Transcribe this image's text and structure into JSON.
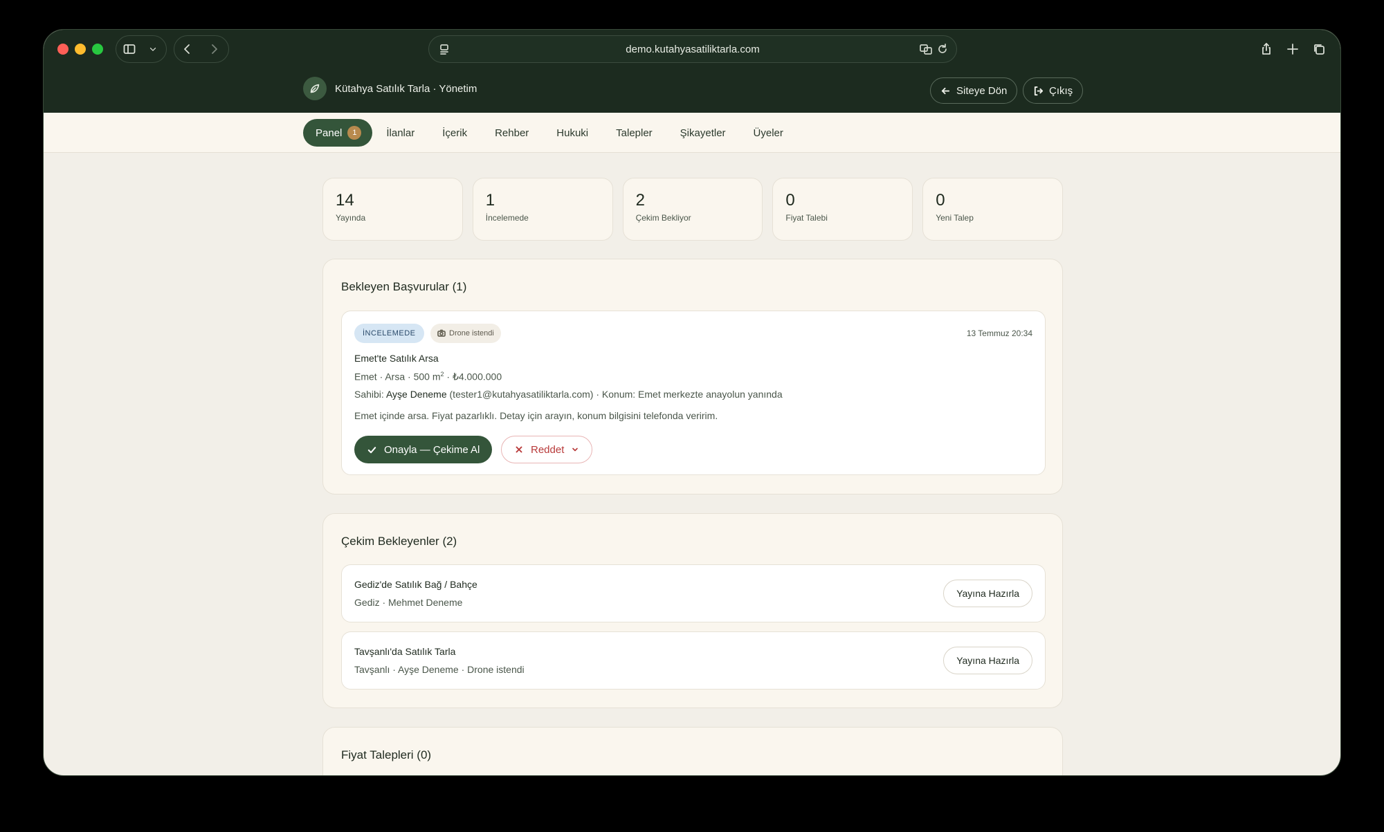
{
  "browser": {
    "url": "demo.kutahyasatiliktarla.com"
  },
  "header": {
    "brand": "Kütahya Satılık Tarla · Yönetim",
    "back_label": "Siteye Dön",
    "logout_label": "Çıkış"
  },
  "nav": {
    "tabs": [
      {
        "label": "Panel",
        "badge": "1",
        "active": true
      },
      {
        "label": "İlanlar"
      },
      {
        "label": "İçerik"
      },
      {
        "label": "Rehber"
      },
      {
        "label": "Hukuki"
      },
      {
        "label": "Talepler"
      },
      {
        "label": "Şikayetler"
      },
      {
        "label": "Üyeler"
      }
    ]
  },
  "stats": [
    {
      "value": "14",
      "label": "Yayında"
    },
    {
      "value": "1",
      "label": "İncelemede"
    },
    {
      "value": "2",
      "label": "Çekim Bekliyor"
    },
    {
      "value": "0",
      "label": "Fiyat Talebi"
    },
    {
      "value": "0",
      "label": "Yeni Talep"
    }
  ],
  "pending": {
    "title": "Bekleyen Başvurular (1)",
    "item": {
      "status": "İNCELEMEDE",
      "drone": "Drone istendi",
      "date": "13 Temmuz 20:34",
      "title": "Emet'te Satılık Arsa",
      "details_pre": "Emet · Arsa · 500 m",
      "details_sup": "2",
      "details_post": " · ₺4.000.000",
      "owner_label": "Sahibi: ",
      "owner_name": "Ayşe Deneme",
      "owner_rest": " (tester1@kutahyasatiliktarla.com) · Konum: Emet merkezte anayolun yanında",
      "description": "Emet içinde arsa. Fiyat pazarlıklı. Detay için arayın, konum bilgisini telefonda veririm.",
      "approve_label": "Onayla — Çekime Al",
      "reject_label": "Reddet"
    }
  },
  "shooting": {
    "title": "Çekim Bekleyenler (2)",
    "items": [
      {
        "title": "Gediz'de Satılık Bağ / Bahçe",
        "sub": "Gediz · Mehmet Deneme",
        "action": "Yayına Hazırla"
      },
      {
        "title": "Tavşanlı'da Satılık Tarla",
        "sub": "Tavşanlı · Ayşe Deneme · Drone istendi",
        "action": "Yayına Hazırla"
      }
    ]
  },
  "price_requests": {
    "title": "Fiyat Talepleri (0)"
  }
}
